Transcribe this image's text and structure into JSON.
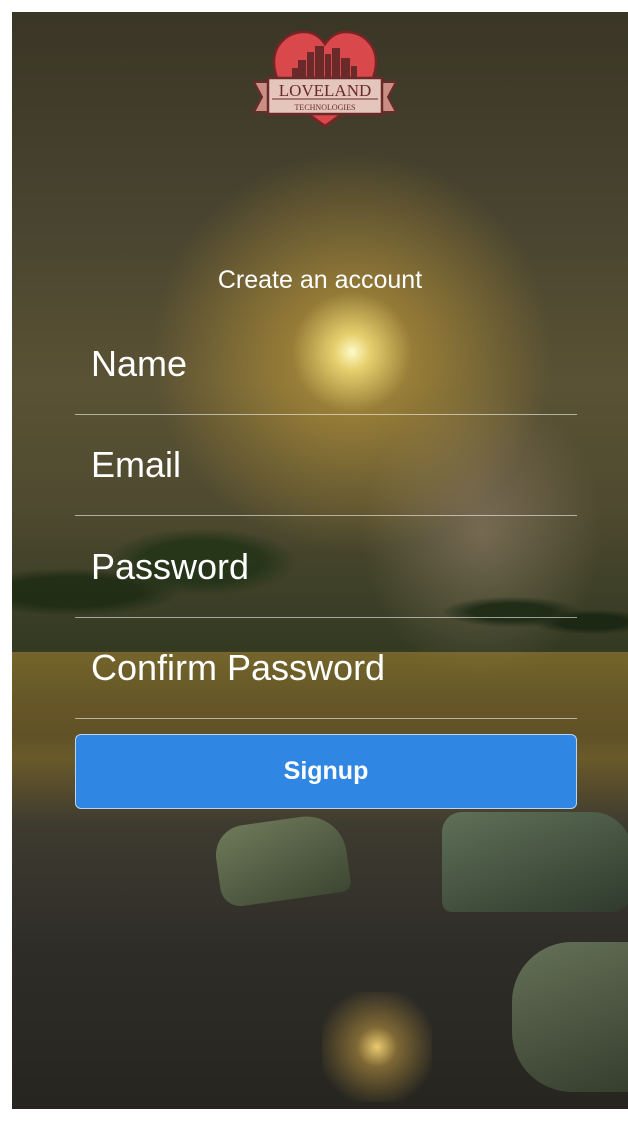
{
  "brand": {
    "name": "LOVELAND",
    "tagline": "TECHNOLOGIES",
    "logo_color": "#d9484b"
  },
  "form": {
    "title": "Create an account",
    "name_placeholder": "Name",
    "email_placeholder": "Email",
    "password_placeholder": "Password",
    "confirm_password_placeholder": "Confirm Password",
    "submit_label": "Signup",
    "submit_color": "#2f86e3"
  }
}
